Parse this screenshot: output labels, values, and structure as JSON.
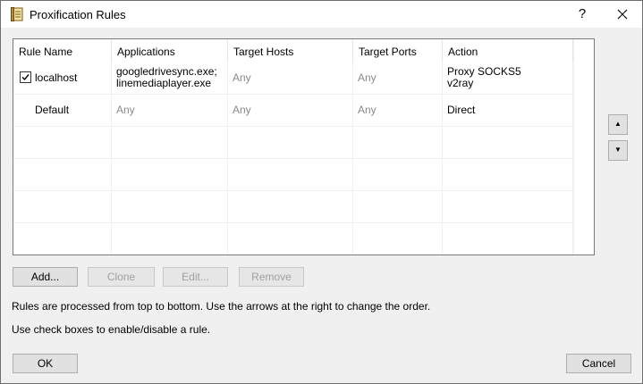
{
  "window": {
    "title": "Proxification Rules",
    "help_glyph": "?"
  },
  "table": {
    "columns": [
      "Rule Name",
      "Applications",
      "Target Hosts",
      "Target Ports",
      "Action"
    ],
    "rows": [
      {
        "name": "localhost",
        "checked": true,
        "applications": [
          "googledrivesync.exe;",
          "linemediaplayer.exe"
        ],
        "hosts": "Any",
        "ports": "Any",
        "action": [
          "Proxy SOCKS5",
          "v2ray"
        ]
      },
      {
        "name": "Default",
        "checked": false,
        "applications": [
          "Any"
        ],
        "hosts": "Any",
        "ports": "Any",
        "action": [
          "Direct"
        ]
      }
    ]
  },
  "order": {
    "up_glyph": "▲",
    "down_glyph": "▼"
  },
  "buttons": {
    "add": "Add...",
    "clone": "Clone",
    "edit": "Edit...",
    "remove": "Remove",
    "ok": "OK",
    "cancel": "Cancel"
  },
  "info": {
    "line1": "Rules are processed from top to bottom. Use the arrows at the right to change the order.",
    "line2": "Use check boxes to enable/disable a rule."
  }
}
